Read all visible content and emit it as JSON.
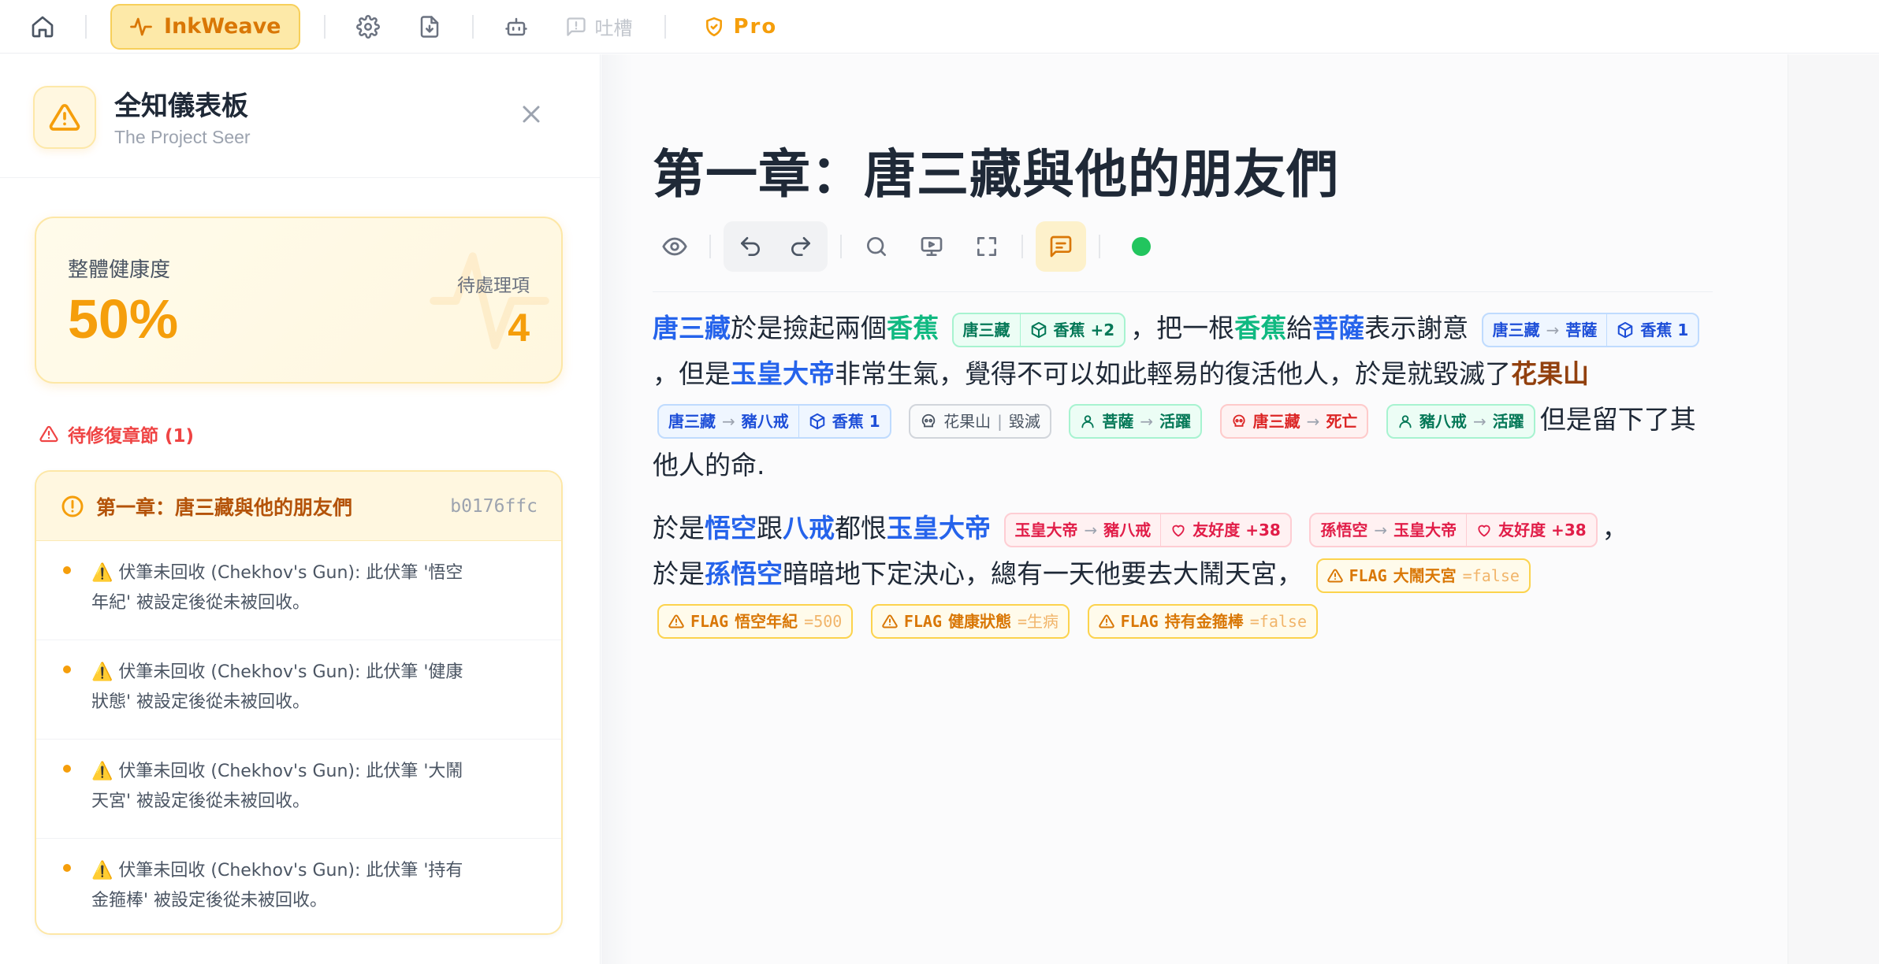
{
  "topbar": {
    "brand": "InkWeave",
    "tucao": "吐槽",
    "pro": "Pro"
  },
  "panel": {
    "title": "全知儀表板",
    "subtitle": "The Project Seer",
    "health_label": "整體健康度",
    "health_value": "50%",
    "pending_label": "待處理項",
    "pending_value": "4",
    "fix_heading": "待修復章節 (1)",
    "chapter_title": "第一章：唐三藏與他的朋友們",
    "chapter_hash": "b0176ffc",
    "issues": [
      {
        "l1": "⚠️ 伏筆未回收 (Chekhov's Gun): 此伏筆 '悟空",
        "l2": "年紀' 被設定後從未被回收。"
      },
      {
        "l1": "⚠️ 伏筆未回收 (Chekhov's Gun): 此伏筆 '健康",
        "l2": "狀態' 被設定後從未被回收。"
      },
      {
        "l1": "⚠️ 伏筆未回收 (Chekhov's Gun): 此伏筆 '大鬧",
        "l2": "天宮' 被設定後從未被回收。"
      },
      {
        "l1": "⚠️ 伏筆未回收 (Chekhov's Gun): 此伏筆 '持有",
        "l2": "金箍棒' 被設定後從未被回收。"
      }
    ]
  },
  "editor": {
    "title": "第一章：唐三藏與他的朋友們",
    "p1": {
      "c1": "唐三藏",
      "t1": "於是撿起兩個",
      "i1": "香蕉",
      "chip1_a": "唐三藏",
      "chip1_b": "香蕉 +2",
      "t2": "，把一根",
      "i2": "香蕉",
      "t3": "給",
      "c2": "菩薩",
      "t4": "表示謝意",
      "chip2_a": "唐三藏",
      "chip2_b": "菩薩",
      "chip2_c": "香蕉 1",
      "t5": "，但是",
      "c3": "玉皇大帝",
      "t6": "非常生氣，覺得不可以如此輕易的復活他人，於是就毀滅了",
      "place1": "花果山",
      "chip3_a": "唐三藏",
      "chip3_b": "豬八戒",
      "chip3_c": "香蕉 1",
      "chip4_a": "花果山",
      "chip4_b": "毀滅",
      "chip5_a": "菩薩",
      "chip5_b": "活躍",
      "chip6_a": "唐三藏",
      "chip6_b": "死亡",
      "chip7_a": "豬八戒",
      "chip7_b": "活躍",
      "t7": "但是留下了其他人的命."
    },
    "p2": {
      "t1": "於是",
      "c1": "悟空",
      "t2": "跟",
      "c2": "八戒",
      "t3": "都恨",
      "c3": "玉皇大帝",
      "chip1_a": "玉皇大帝",
      "chip1_b": "豬八戒",
      "chip1_c": "友好度 +38",
      "chip2_a": "孫悟空",
      "chip2_b": "玉皇大帝",
      "chip2_c": "友好度 +38",
      "t4": "，",
      "t5": "於是",
      "c4": "孫悟空",
      "t6": "暗暗地下定決心，總有一天他要去大鬧天宮，",
      "flag_prefix": "FLAG",
      "flag1_k": "大鬧天宮",
      "flag1_v": "=false",
      "flag2_k": "悟空年紀",
      "flag2_v": "=500",
      "flag3_k": "健康狀態",
      "flag3_v": "=生病",
      "flag4_k": "持有金箍棒",
      "flag4_v": "=false"
    }
  },
  "colors": {
    "accent": "#f59e0b",
    "character": "#2563eb",
    "item": "#10b981",
    "place": "#92400e",
    "status_online": "#22c55e"
  },
  "icons": [
    "home-icon",
    "activity-icon",
    "gear-icon",
    "file-download-icon",
    "robot-icon",
    "chat-icon",
    "shield-check-icon",
    "warning-triangle-icon",
    "close-icon",
    "eye-icon",
    "undo-icon",
    "redo-icon",
    "search-icon",
    "monitor-icon",
    "fullscreen-icon",
    "comment-icon"
  ]
}
